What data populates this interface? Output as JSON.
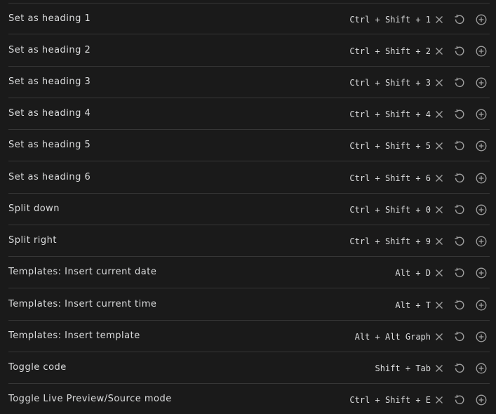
{
  "commands": [
    {
      "label": "Set as heading 1",
      "hotkey": "Ctrl + Shift + 1"
    },
    {
      "label": "Set as heading 2",
      "hotkey": "Ctrl + Shift + 2"
    },
    {
      "label": "Set as heading 3",
      "hotkey": "Ctrl + Shift + 3"
    },
    {
      "label": "Set as heading 4",
      "hotkey": "Ctrl + Shift + 4"
    },
    {
      "label": "Set as heading 5",
      "hotkey": "Ctrl + Shift + 5"
    },
    {
      "label": "Set as heading 6",
      "hotkey": "Ctrl + Shift + 6"
    },
    {
      "label": "Split down",
      "hotkey": "Ctrl + Shift + 0"
    },
    {
      "label": "Split right",
      "hotkey": "Ctrl + Shift + 9"
    },
    {
      "label": "Templates: Insert current date",
      "hotkey": "Alt + D"
    },
    {
      "label": "Templates: Insert current time",
      "hotkey": "Alt + T"
    },
    {
      "label": "Templates: Insert template",
      "hotkey": "Alt + Alt Graph"
    },
    {
      "label": "Toggle code",
      "hotkey": "Shift + Tab"
    },
    {
      "label": "Toggle Live Preview/Source mode",
      "hotkey": "Ctrl + Shift + E"
    }
  ],
  "icons": {
    "remove": "close-icon",
    "reset": "reset-icon",
    "add": "plus-circle-icon"
  },
  "colors": {
    "background": "#1a1a1a",
    "text": "#dcddde",
    "icon": "#a0a0a0",
    "divider": "#363636"
  }
}
